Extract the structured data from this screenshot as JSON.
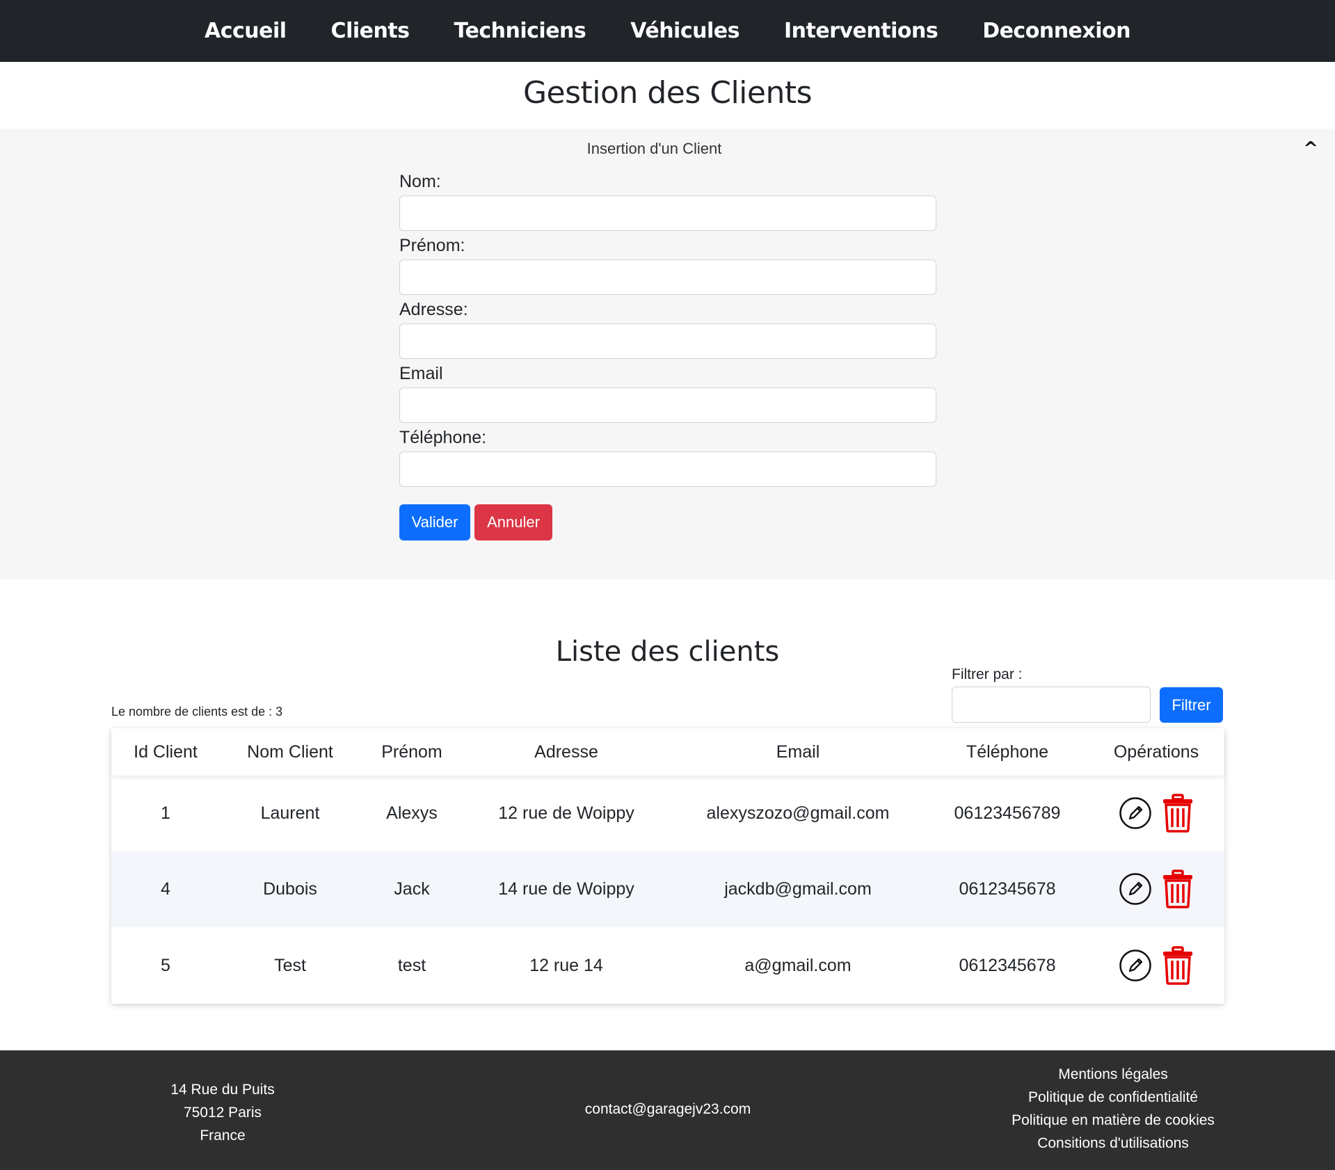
{
  "nav": {
    "items": [
      {
        "label": "Accueil"
      },
      {
        "label": "Clients"
      },
      {
        "label": "Techniciens"
      },
      {
        "label": "Véhicules"
      },
      {
        "label": "Interventions"
      },
      {
        "label": "Deconnexion"
      }
    ]
  },
  "page": {
    "title": "Gestion des Clients"
  },
  "insert_form": {
    "title": "Insertion d'un Client",
    "toggle": "^",
    "fields": [
      {
        "label": "Nom:",
        "value": ""
      },
      {
        "label": "Prénom:",
        "value": ""
      },
      {
        "label": "Adresse:",
        "value": ""
      },
      {
        "label": "Email",
        "value": ""
      },
      {
        "label": "Téléphone:",
        "value": ""
      }
    ],
    "submit_label": "Valider",
    "cancel_label": "Annuler"
  },
  "list": {
    "title": "Liste des clients",
    "count_text": "Le nombre de clients est de : 3",
    "filter": {
      "label": "Filtrer par :",
      "value": "",
      "button_label": "Filtrer"
    },
    "columns": [
      "Id Client",
      "Nom Client",
      "Prénom",
      "Adresse",
      "Email",
      "Téléphone",
      "Opérations"
    ],
    "rows": [
      [
        "1",
        "Laurent",
        "Alexys",
        "12 rue de Woippy",
        "alexyszozo@gmail.com",
        "06123456789"
      ],
      [
        "4",
        "Dubois",
        "Jack",
        "14 rue de Woippy",
        "jackdb@gmail.com",
        "0612345678"
      ],
      [
        "5",
        "Test",
        "test",
        "12 rue 14",
        "a@gmail.com",
        "0612345678"
      ]
    ],
    "row_actions": [
      "edit-icon",
      "trash-icon"
    ]
  },
  "footer": {
    "address": [
      "14 Rue du Puits",
      "75012 Paris",
      "France"
    ],
    "email": "contact@garagejv23.com",
    "links": [
      "Mentions légales",
      "Politique de confidentialité",
      "Politique en matière de cookies",
      "Consitions d'utilisations"
    ]
  },
  "colors": {
    "navbar": "#212529",
    "primary": "#0d6efd",
    "danger": "#dc3545",
    "trash": "#e60000",
    "panel_bg": "#f6f6f6",
    "footer_bg": "#2f2f2f"
  }
}
